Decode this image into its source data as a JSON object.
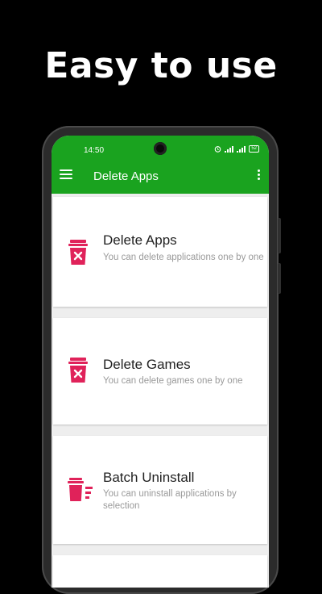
{
  "headline": "Easy to use",
  "status": {
    "time": "14:50",
    "battery": "52"
  },
  "appbar": {
    "title": "Delete Apps"
  },
  "items": [
    {
      "title": "Delete Apps",
      "subtitle": "You can delete applications one by one"
    },
    {
      "title": "Delete Games",
      "subtitle": "You can delete games one by one"
    },
    {
      "title": "Batch Uninstall",
      "subtitle": "You can uninstall applications by selection"
    }
  ],
  "colors": {
    "accent": "#1aa31f",
    "icon": "#e0225a",
    "background": "#000000"
  },
  "icons": {
    "menu": "hamburger-icon",
    "more": "more-vert-icon",
    "item": "trash-icon",
    "batch": "batch-trash-icon"
  }
}
